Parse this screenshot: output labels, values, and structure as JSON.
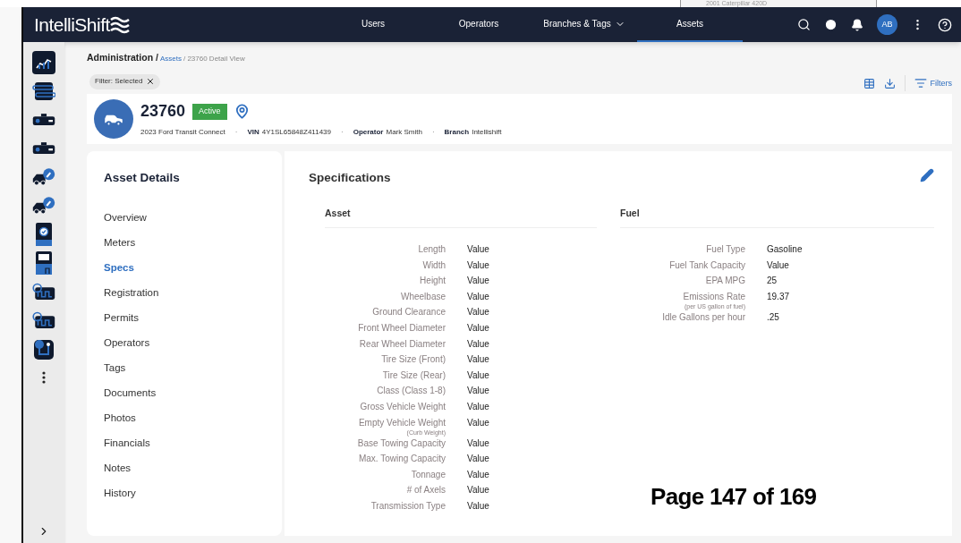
{
  "background_window": {
    "text": "2001 Caterpillar 420D"
  },
  "app": {
    "logo": "IntelliShift",
    "nav": [
      {
        "label": "Users",
        "selected": false,
        "dropdown": false
      },
      {
        "label": "Operators",
        "selected": false,
        "dropdown": false
      },
      {
        "label": "Branches & Tags",
        "selected": false,
        "dropdown": true
      },
      {
        "label": "Assets",
        "selected": true,
        "dropdown": false
      }
    ],
    "avatar": "AB"
  },
  "rail": [
    {
      "kind": "chart",
      "selected": true
    },
    {
      "kind": "sliders",
      "selected": false
    },
    {
      "kind": "dashcam",
      "selected": false
    },
    {
      "kind": "dashcam",
      "selected": false
    },
    {
      "kind": "truck-wrench",
      "selected": false
    },
    {
      "kind": "truck-wrench",
      "selected": false
    },
    {
      "kind": "tablet",
      "selected": false
    },
    {
      "kind": "device",
      "selected": false
    },
    {
      "kind": "sensor",
      "selected": false
    },
    {
      "kind": "sensor",
      "selected": false
    },
    {
      "kind": "route",
      "selected": false
    },
    {
      "kind": "more",
      "selected": false
    }
  ],
  "breadcrumb": {
    "root": "Administration /",
    "link": "Assets",
    "rest": "/ 23760 Detail View"
  },
  "filter_chip": "Filter: Selected",
  "toolbar": {
    "filters": "Filters"
  },
  "asset": {
    "number": "23760",
    "status": "Active",
    "model": "2023 Ford Transit Connect",
    "separator": "·",
    "fields": [
      {
        "label": "VIN",
        "value": "4Y1SL65848Z411439"
      },
      {
        "label": "Operator",
        "value": "Mark Smith"
      },
      {
        "label": "Branch",
        "value": "Intellishift"
      }
    ]
  },
  "details_nav": {
    "title": "Asset Details",
    "items": [
      {
        "label": "Overview",
        "selected": false
      },
      {
        "label": "Meters",
        "selected": false
      },
      {
        "label": "Specs",
        "selected": true
      },
      {
        "label": "Registration",
        "selected": false
      },
      {
        "label": "Permits",
        "selected": false
      },
      {
        "label": "Operators",
        "selected": false
      },
      {
        "label": "Tags",
        "selected": false
      },
      {
        "label": "Documents",
        "selected": false
      },
      {
        "label": "Photos",
        "selected": false
      },
      {
        "label": "Financials",
        "selected": false
      },
      {
        "label": "Notes",
        "selected": false
      },
      {
        "label": "History",
        "selected": false
      }
    ]
  },
  "specifications": {
    "title": "Specifications",
    "sections": [
      {
        "title": "Asset",
        "rows": [
          {
            "label": "Length",
            "value": "Value"
          },
          {
            "label": "Width",
            "value": "Value"
          },
          {
            "label": "Height",
            "value": "Value"
          },
          {
            "label": "Wheelbase",
            "value": "Value"
          },
          {
            "label": "Ground Clearance",
            "value": "Value"
          },
          {
            "label": "Front Wheel Diameter",
            "value": "Value"
          },
          {
            "label": "Rear Wheel Diameter",
            "value": "Value"
          },
          {
            "label": "Tire Size (Front)",
            "value": "Value"
          },
          {
            "label": "Tire Size (Rear)",
            "value": "Value"
          },
          {
            "label": "Class (Class 1-8)",
            "value": "Value"
          },
          {
            "label": "Gross Vehicle Weight",
            "value": "Value"
          },
          {
            "label": "Empty Vehicle Weight",
            "note": "(Curb Weight)",
            "value": "Value"
          },
          {
            "label": "Base Towing Capacity",
            "value": "Value"
          },
          {
            "label": "Max. Towing Capacity",
            "value": "Value"
          },
          {
            "label": "Tonnage",
            "value": "Value"
          },
          {
            "label": "# of Axels",
            "value": "Value"
          },
          {
            "label": "Transmission Type",
            "value": "Value"
          }
        ]
      },
      {
        "title": "Fuel",
        "rows": [
          {
            "label": "Fuel Type",
            "value": "Gasoline"
          },
          {
            "label": "Fuel Tank Capacity",
            "value": "Value"
          },
          {
            "label": "EPA MPG",
            "value": "25"
          },
          {
            "label": "Emissions Rate",
            "note": "(per US gallon of fuel)",
            "value": "19.37"
          },
          {
            "label": "Idle Gallons per hour",
            "value": ".25"
          }
        ]
      }
    ]
  },
  "page_label": "Page 147 of 169"
}
